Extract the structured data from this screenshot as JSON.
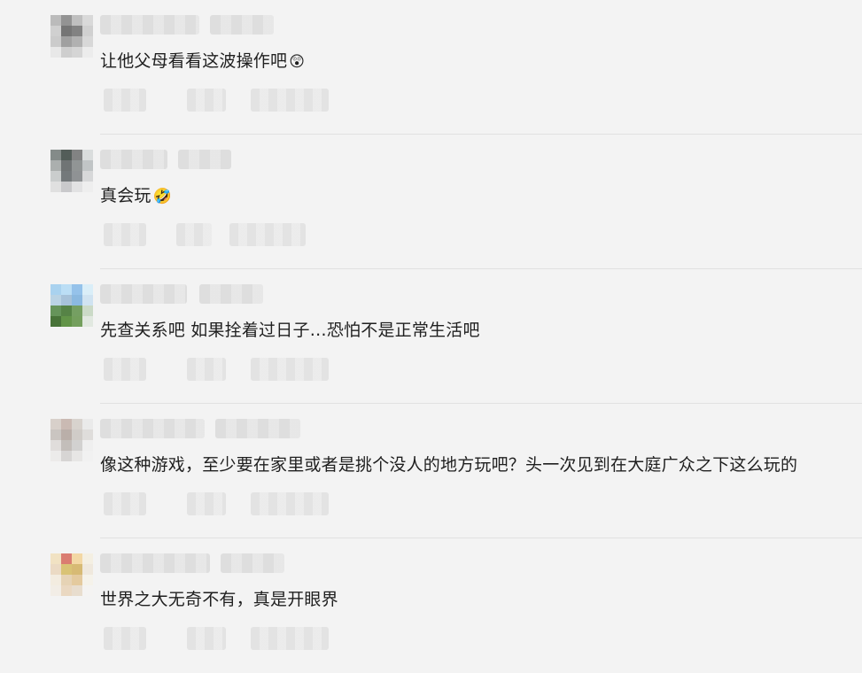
{
  "comments": [
    {
      "text": "让他父母看看这波操作吧",
      "emoji": "😲",
      "avatar_colors": [
        "#b9b9b9",
        "#8e8e8e",
        "#bdbdbd",
        "#d8d8d8",
        "#cfcfcf",
        "#6f6f6f",
        "#7c7c7c",
        "#cfcfcf",
        "#c9c9c9",
        "#9c9c9c",
        "#aeaeae",
        "#d7d7d7",
        "#e8e8e8",
        "#cdcdcd",
        "#d4d4d4",
        "#ececec"
      ]
    },
    {
      "text": "真会玩",
      "emoji": "🤣",
      "avatar_colors": [
        "#7f8684",
        "#4b5651",
        "#7c7e7e",
        "#d9dcdc",
        "#a8acab",
        "#6a6e6f",
        "#8c9190",
        "#bfc3c4",
        "#c8cbcb",
        "#6e7375",
        "#8a8d8f",
        "#d6d7d8",
        "#dfdfe0",
        "#c7c7c9",
        "#e2e2e3",
        "#eeeeee"
      ]
    },
    {
      "text": "先查关系吧 如果拴着过日子…恐怕不是正常生活吧",
      "emoji": "",
      "avatar_colors": [
        "#a6d1ef",
        "#b9ddf6",
        "#90c0ea",
        "#d9eef9",
        "#b8d2e4",
        "#a3c0d8",
        "#86b6df",
        "#cfe3f1",
        "#5f8f52",
        "#4e7e3d",
        "#6f9b5b",
        "#c9d9c5",
        "#3f6d2f",
        "#5b8f3f",
        "#6e9b56",
        "#e1e8df"
      ]
    },
    {
      "text": "像这种游戏，至少要在家里或者是挑个没人的地方玩吧？头一次见到在大庭广众之下这么玩的",
      "emoji": "",
      "avatar_colors": [
        "#d7cfc8",
        "#c8b8b0",
        "#d7d2cd",
        "#eaeaea",
        "#c8c3bf",
        "#b7aca6",
        "#cfcac6",
        "#dedcda",
        "#dfdcda",
        "#c1bcb8",
        "#d1d0cf",
        "#efefef",
        "#ecebea",
        "#d6d4d3",
        "#e7e6e5",
        "#f1f1f1"
      ]
    },
    {
      "text": "世界之大无奇不有，真是开眼界",
      "emoji": "",
      "avatar_colors": [
        "#f1e2c1",
        "#d9776b",
        "#f3d7a0",
        "#f5efe2",
        "#ebd9c2",
        "#d8c16f",
        "#d6b76e",
        "#efe8dc",
        "#f3ecdf",
        "#e6d2b2",
        "#e4c89a",
        "#f6f2ea",
        "#f2ede6",
        "#ead7bf",
        "#e8dccd",
        "#f5f4f2"
      ]
    }
  ]
}
